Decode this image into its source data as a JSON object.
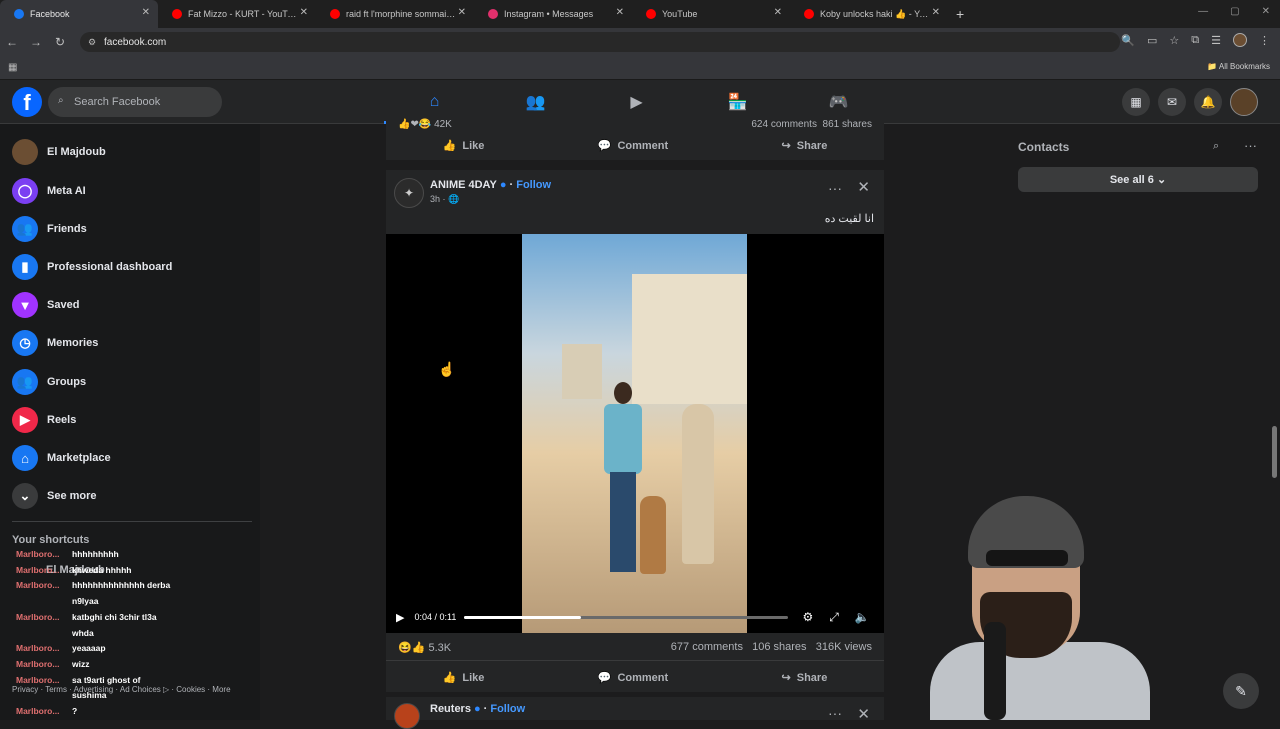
{
  "browser": {
    "tabs": [
      {
        "title": "Facebook",
        "color": "#1877f2",
        "active": true
      },
      {
        "title": "Fat Mizzo - KURT - YouTube",
        "color": "#ff0000",
        "active": false
      },
      {
        "title": "raid ft l'morphine sommaire - Y",
        "color": "#ff0000",
        "active": false
      },
      {
        "title": "Instagram • Messages",
        "color": "#e1306c",
        "active": false
      },
      {
        "title": "YouTube",
        "color": "#ff0000",
        "active": false
      },
      {
        "title": "Koby unlocks haki 👍 - YouTub",
        "color": "#ff0000",
        "active": false
      }
    ],
    "url": "facebook.com",
    "all_bookmarks": "All Bookmarks"
  },
  "header": {
    "logo": "f",
    "search_placeholder": "Search Facebook",
    "nav": [
      "home-icon",
      "friends-icon",
      "video-icon",
      "marketplace-icon",
      "gaming-icon"
    ]
  },
  "sidebar": {
    "items": [
      {
        "label": "El Majdoub",
        "icon": "avatar",
        "color": "#6b4e33"
      },
      {
        "label": "Meta AI",
        "icon": "meta-ai-icon",
        "color": "#7b3ff2"
      },
      {
        "label": "Friends",
        "icon": "friends-icon",
        "color": "#1877f2"
      },
      {
        "label": "Professional dashboard",
        "icon": "dashboard-icon",
        "color": "#1877f2"
      },
      {
        "label": "Saved",
        "icon": "bookmark-icon",
        "color": "#a033ff"
      },
      {
        "label": "Memories",
        "icon": "clock-icon",
        "color": "#1877f2"
      },
      {
        "label": "Groups",
        "icon": "groups-icon",
        "color": "#1877f2"
      },
      {
        "label": "Reels",
        "icon": "reels-icon",
        "color": "#f02849"
      },
      {
        "label": "Marketplace",
        "icon": "shop-icon",
        "color": "#1877f2"
      },
      {
        "label": "See more",
        "icon": "chevron-down-icon",
        "color": "#3a3b3c"
      }
    ],
    "shortcuts_title": "Your shortcuts",
    "shortcut_overlay": "El Majdoub",
    "footer": "Privacy · Terms · Advertising · Ad Choices ▷ · Cookies · More"
  },
  "chat": [
    {
      "user": "Marlboro...",
      "msg": "hhhhhhhhh"
    },
    {
      "user": "Marlboro...",
      "msg": "khweda hhhhh"
    },
    {
      "user": "Marlboro...",
      "msg": "hhhhhhhhhhhhhh derba"
    },
    {
      "user": "",
      "msg": "n9lyaa"
    },
    {
      "user": "Marlboro...",
      "msg": "katbghi chi 3chir tl3a"
    },
    {
      "user": "",
      "msg": "whda"
    },
    {
      "user": "Marlboro...",
      "msg": "yeaaaap"
    },
    {
      "user": "Marlboro...",
      "msg": "wizz"
    },
    {
      "user": "Marlboro...",
      "msg": "sa t9arti ghost of"
    },
    {
      "user": "",
      "msg": "sushima"
    },
    {
      "user": "Marlboro...",
      "msg": "?"
    }
  ],
  "prev_post": {
    "reactions": "42K",
    "comments": "624 comments",
    "shares": "861 shares"
  },
  "actions": {
    "like": "Like",
    "comment": "Comment",
    "share": "Share"
  },
  "post": {
    "page_name": "ANIME 4DAY",
    "follow": "Follow",
    "time": "3h · 🌐",
    "caption": "انا لقيت ده",
    "video_time": "0:04 / 0:11",
    "progress": 0.36,
    "reactions": "5.3K",
    "comments": "677 comments",
    "shares": "106 shares",
    "views": "316K views"
  },
  "next_post": {
    "page_name": "Reuters",
    "follow": "Follow"
  },
  "contacts": {
    "title": "Contacts",
    "see_all": "See all 6"
  }
}
